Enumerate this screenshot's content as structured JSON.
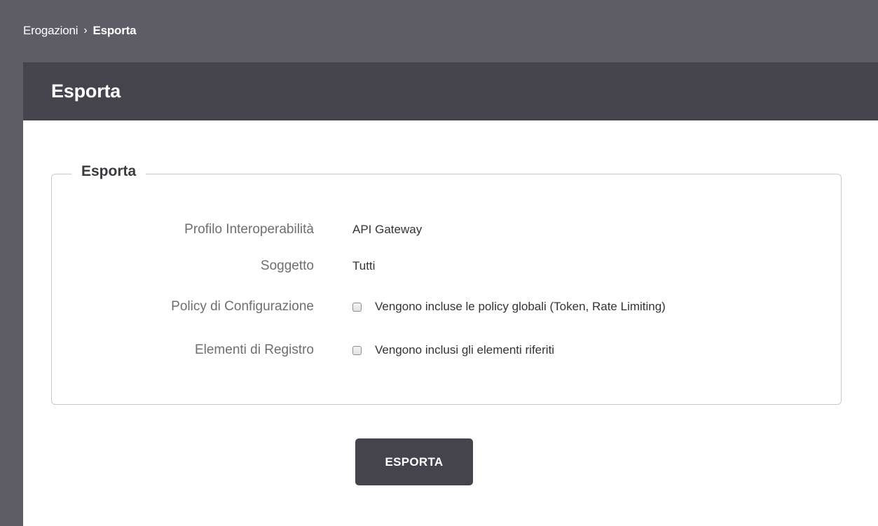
{
  "breadcrumb": {
    "parent": "Erogazioni",
    "separator": "›",
    "current": "Esporta"
  },
  "panel": {
    "title": "Esporta"
  },
  "form": {
    "legend": "Esporta",
    "rows": [
      {
        "label": "Profilo Interoperabilità",
        "value": "API Gateway"
      },
      {
        "label": "Soggetto",
        "value": "Tutti"
      },
      {
        "label": "Policy di Configurazione",
        "checkbox_label": "Vengono incluse le policy globali (Token, Rate Limiting)",
        "checked": false
      },
      {
        "label": "Elementi di Registro",
        "checkbox_label": "Vengono inclusi gli elementi riferiti",
        "checked": false
      }
    ]
  },
  "actions": {
    "export_label": "ESPORTA"
  },
  "colors": {
    "background": "#5e5d65",
    "header": "#45444c",
    "button": "#45444c"
  }
}
